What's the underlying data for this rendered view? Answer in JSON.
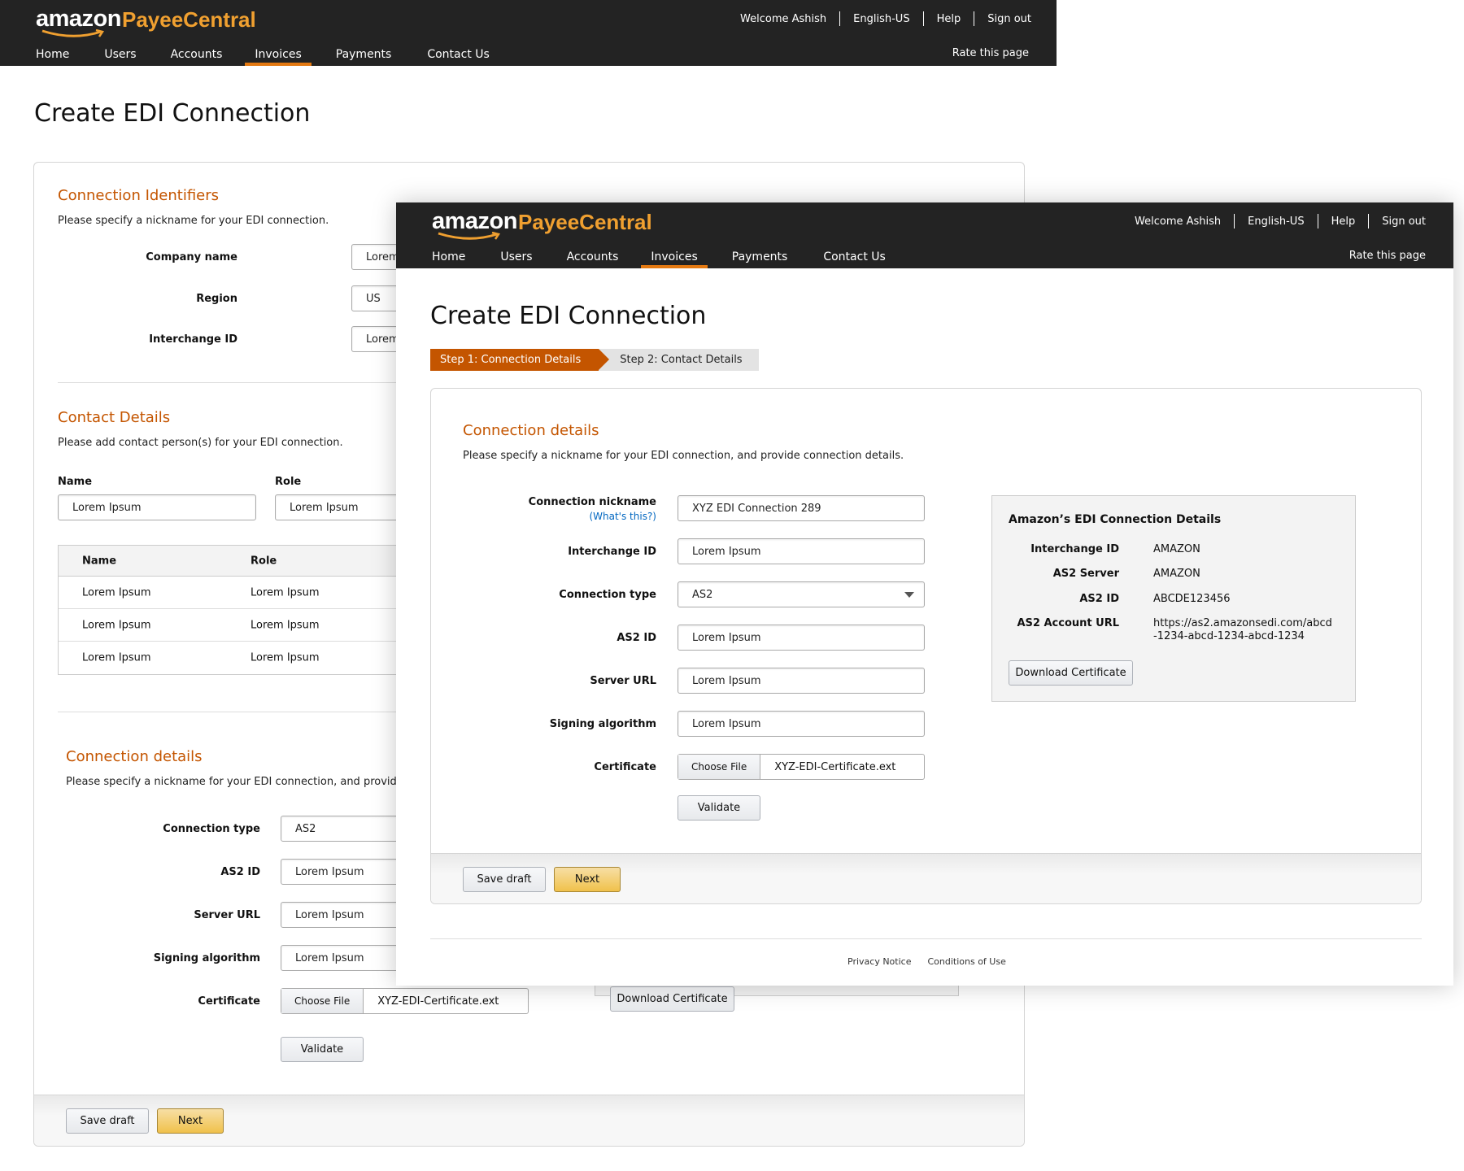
{
  "header": {
    "logo_amazon": "amazon",
    "logo_product": "PayeeCentral",
    "welcome": "Welcome Ashish",
    "language": "English-US",
    "help": "Help",
    "sign_out": "Sign out",
    "rate": "Rate this page",
    "nav": [
      "Home",
      "Users",
      "Accounts",
      "Invoices",
      "Payments",
      "Contact Us"
    ],
    "active_nav": "Invoices"
  },
  "page_title": "Create EDI Connection",
  "back_page": {
    "identifiers": {
      "title": "Connection Identifiers",
      "desc": "Please specify a nickname for your EDI connection.",
      "company_label": "Company name",
      "company_value": "Lorem",
      "region_label": "Region",
      "region_value": "US",
      "interchange_label": "Interchange ID",
      "interchange_value": "Lorem"
    },
    "contacts": {
      "title": "Contact Details",
      "desc": "Please add contact person(s) for your EDI connection.",
      "name_label": "Name",
      "role_label": "Role",
      "name_value": "Lorem Ipsum",
      "role_value": "Lorem Ipsum",
      "table_headers": [
        "Name",
        "Role"
      ],
      "rows": [
        [
          "Lorem Ipsum",
          "Lorem Ipsum"
        ],
        [
          "Lorem Ipsum",
          "Lorem Ipsum"
        ],
        [
          "Lorem Ipsum",
          "Lorem Ipsum"
        ]
      ]
    },
    "connection": {
      "title": "Connection details",
      "desc": "Please specify a nickname for your EDI connection, and provide conn",
      "type_label": "Connection type",
      "type_value": "AS2",
      "as2_label": "AS2 ID",
      "as2_value": "Lorem Ipsum",
      "server_label": "Server URL",
      "server_value": "Lorem Ipsum",
      "signing_label": "Signing algorithm",
      "signing_value": "Lorem Ipsum",
      "cert_label": "Certificate",
      "choose_file": "Choose File",
      "cert_file": "XYZ-EDI-Certificate.ext",
      "validate": "Validate",
      "download_cert": "Download Certificate"
    },
    "save_draft": "Save draft",
    "next": "Next"
  },
  "front_page": {
    "step1": "Step 1: Connection Details",
    "step2": "Step 2: Contact Details",
    "section_title": "Connection details",
    "section_desc": "Please specify a nickname for your EDI connection, and provide connection details.",
    "nickname_label": "Connection nickname",
    "whats_this": "(What's this?)",
    "nickname_value": "XYZ EDI Connection 289",
    "interchange_label": "Interchange ID",
    "interchange_value": "Lorem Ipsum",
    "type_label": "Connection type",
    "type_value": "AS2",
    "as2_label": "AS2 ID",
    "as2_value": "Lorem Ipsum",
    "server_label": "Server URL",
    "server_value": "Lorem Ipsum",
    "signing_label": "Signing algorithm",
    "signing_value": "Lorem Ipsum",
    "cert_label": "Certificate",
    "choose_file": "Choose File",
    "cert_file": "XYZ-EDI-Certificate.ext",
    "validate": "Validate",
    "amazon_box": {
      "title": "Amazon’s EDI Connection Details",
      "interchange_label": "Interchange ID",
      "interchange_value": "AMAZON",
      "server_label": "AS2 Server",
      "server_value": "AMAZON",
      "as2_label": "AS2 ID",
      "as2_value": "ABCDE123456",
      "url_label": "AS2 Account URL",
      "url_line1": "https://as2.amazonsedi.com/abcd",
      "url_line2": "-1234-abcd-1234-abcd-1234",
      "download_cert": "Download Certificate"
    },
    "save_draft": "Save draft",
    "next": "Next",
    "footer": {
      "privacy": "Privacy Notice",
      "conditions": "Conditions of Use"
    }
  },
  "colors": {
    "header_bg": "#232323",
    "accent_orange": "#c45500",
    "nav_underline": "#e47911",
    "logo_orange": "#f0a030",
    "primary_button": "#f0c14b",
    "link_blue": "#0066c0"
  }
}
